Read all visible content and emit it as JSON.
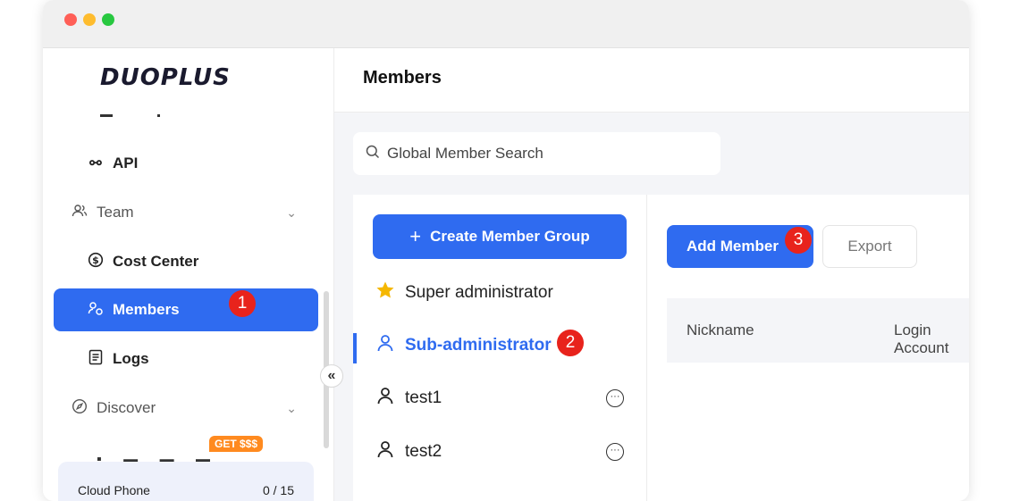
{
  "window": {
    "controls": [
      "close",
      "minimize",
      "zoom"
    ]
  },
  "sidebar": {
    "logo": "DUOPLUS",
    "items": [
      {
        "label": "API",
        "icon": "api-icon"
      },
      {
        "label": "Team",
        "icon": "team-icon",
        "expandable": true
      },
      {
        "label": "Cost Center",
        "icon": "dollar-icon"
      },
      {
        "label": "Members",
        "icon": "members-icon",
        "active": true
      },
      {
        "label": "Logs",
        "icon": "logs-icon"
      },
      {
        "label": "Discover",
        "icon": "compass-icon",
        "expandable": true
      }
    ],
    "promo_badge": "GET $$$",
    "quota": {
      "label": "Cloud Phone",
      "value": "0 / 15"
    },
    "step_markers": {
      "members": "1"
    }
  },
  "main": {
    "title": "Members",
    "search": {
      "placeholder": "Global Member Search"
    },
    "groups": {
      "create_label": "Create Member Group",
      "items": [
        {
          "label": "Super administrator",
          "icon": "star-icon"
        },
        {
          "label": "Sub-administrator",
          "icon": "user-icon",
          "active": true
        },
        {
          "label": "test1",
          "icon": "user-icon",
          "has_more": true
        },
        {
          "label": "test2",
          "icon": "user-icon",
          "has_more": true
        }
      ],
      "step_marker": "2"
    },
    "members": {
      "add_label": "Add Member",
      "export_label": "Export",
      "step_marker": "3",
      "columns": [
        "Nickname",
        "Login Account"
      ]
    }
  },
  "colors": {
    "accent": "#2f6bf0",
    "marker": "#e8231c",
    "promo": "#ff8a1f"
  }
}
